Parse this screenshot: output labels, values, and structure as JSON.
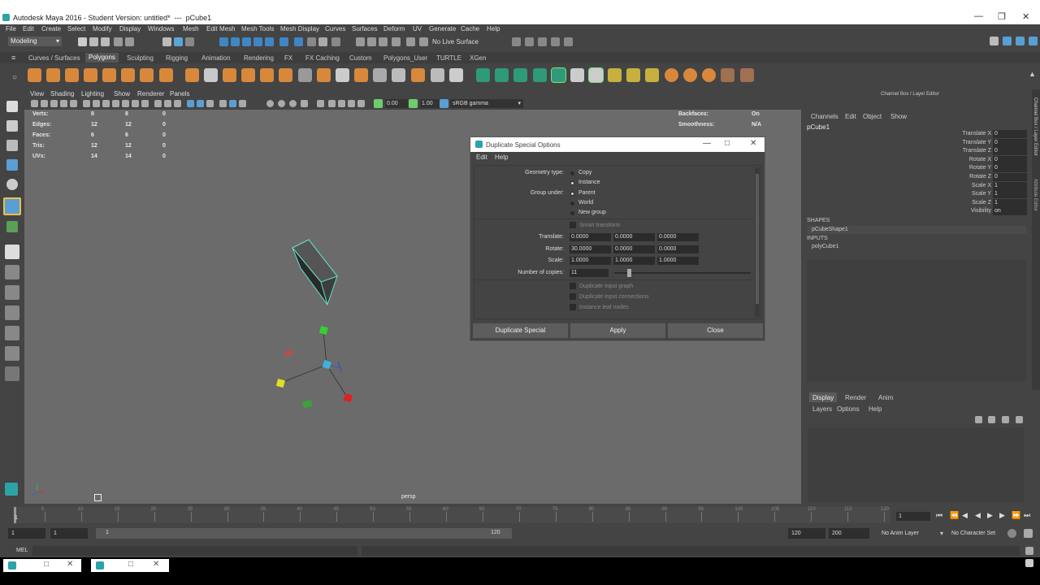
{
  "window": {
    "title": "Autodesk Maya 2016 - Student Version: untitled*  ---  pCube1"
  },
  "menubar": [
    "File",
    "Edit",
    "Create",
    "Select",
    "Modify",
    "Display",
    "Windows",
    "Mesh",
    "Edit Mesh",
    "Mesh Tools",
    "Mesh Display",
    "Curves",
    "Surfaces",
    "Deform",
    "UV",
    "Generate",
    "Cache",
    "Help"
  ],
  "status": {
    "mode": "Modeling",
    "live_surface": "No Live Surface"
  },
  "shelf_tabs": [
    "Curves / Surfaces",
    "Polygons",
    "Sculpting",
    "Rigging",
    "Animation",
    "Rendering",
    "FX",
    "FX Caching",
    "Custom",
    "Polygons_User",
    "TURTLE",
    "XGen"
  ],
  "shelf_active": "Polygons",
  "viewport": {
    "menu": [
      "View",
      "Shading",
      "Lighting",
      "Show",
      "Renderer",
      "Panels"
    ],
    "exposure": "0.00",
    "gamma": "1.00",
    "color_space": "sRGB gamma",
    "camera": "persp",
    "hud_left": [
      {
        "label": "Verts:",
        "a": "8",
        "b": "8",
        "c": "0"
      },
      {
        "label": "Edges:",
        "a": "12",
        "b": "12",
        "c": "0"
      },
      {
        "label": "Faces:",
        "a": "6",
        "b": "6",
        "c": "0"
      },
      {
        "label": "Tris:",
        "a": "12",
        "b": "12",
        "c": "0"
      },
      {
        "label": "UVs:",
        "a": "14",
        "b": "14",
        "c": "0"
      }
    ],
    "hud_right": [
      {
        "label": "Backfaces:",
        "value": "On"
      },
      {
        "label": "Smoothness:",
        "value": "N/A"
      }
    ]
  },
  "dialog": {
    "title": "Duplicate Special Options",
    "menu": [
      "Edit",
      "Help"
    ],
    "geometry_type_label": "Geometry type:",
    "geometry_type_options": [
      "Copy",
      "Instance"
    ],
    "group_under_label": "Group under:",
    "group_under_options": [
      "Parent",
      "World",
      "New group"
    ],
    "smart_transform": "Smart transform",
    "translate_label": "Translate:",
    "translate": [
      "0.0000",
      "0.0000",
      "0.0000"
    ],
    "rotate_label": "Rotate:",
    "rotate": [
      "30.0000",
      "0.0000",
      "0.0000"
    ],
    "scale_label": "Scale:",
    "scale": [
      "1.0000",
      "1.0000",
      "1.0000"
    ],
    "copies_label": "Number of copies:",
    "copies": "11",
    "checkboxes": [
      "Duplicate input graph",
      "Duplicate input connections",
      "Instance leaf nodes"
    ],
    "buttons": [
      "Duplicate Special",
      "Apply",
      "Close"
    ]
  },
  "channel_box": {
    "header": "Channel Box / Layer Editor",
    "menu": [
      "Channels",
      "Edit",
      "Object",
      "Show"
    ],
    "object": "pCube1",
    "channels": [
      {
        "name": "Translate X",
        "value": "0"
      },
      {
        "name": "Translate Y",
        "value": "0"
      },
      {
        "name": "Translate Z",
        "value": "0"
      },
      {
        "name": "Rotate X",
        "value": "0"
      },
      {
        "name": "Rotate Y",
        "value": "0"
      },
      {
        "name": "Rotate Z",
        "value": "0"
      },
      {
        "name": "Scale X",
        "value": "1"
      },
      {
        "name": "Scale Y",
        "value": "1"
      },
      {
        "name": "Scale Z",
        "value": "1"
      },
      {
        "name": "Visibility",
        "value": "on"
      }
    ],
    "shapes_label": "SHAPES",
    "shape": "pCubeShape1",
    "inputs_label": "INPUTS",
    "input": "polyCube1",
    "side_tabs": [
      "Channel Box / Layer Editor",
      "Attribute Editor"
    ]
  },
  "layer_editor": {
    "tabs": [
      "Display",
      "Render",
      "Anim"
    ],
    "menu": [
      "Layers",
      "Options",
      "Help"
    ]
  },
  "timeline": {
    "ticks": [
      "5",
      "10",
      "15",
      "20",
      "25",
      "30",
      "35",
      "40",
      "45",
      "50",
      "55",
      "60",
      "65",
      "70",
      "75",
      "80",
      "85",
      "90",
      "95",
      "100",
      "105",
      "110",
      "115",
      "120"
    ],
    "start_tick": "1",
    "current_frame": "1"
  },
  "range": {
    "start": "1",
    "playback_start": "1",
    "slider_start": "1",
    "slider_end": "120",
    "playback_end": "120",
    "end": "200",
    "anim_layer": "No Anim Layer",
    "char_set": "No Character Set"
  },
  "cmdline": {
    "label": "MEL"
  }
}
